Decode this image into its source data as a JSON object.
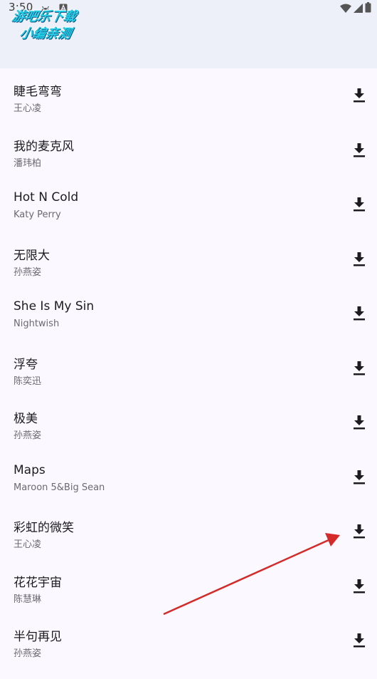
{
  "status_bar": {
    "time": "3:50",
    "icons": [
      "android-icon",
      "a-notification-icon",
      "wifi-icon",
      "signal-icon",
      "battery-icon"
    ]
  },
  "watermark": {
    "line1": "游吧乐下载",
    "line2": "小编亲测"
  },
  "songs": [
    {
      "title": "睫毛弯弯",
      "artist": "王心凌"
    },
    {
      "title": "我的麦克风",
      "artist": "潘玮柏"
    },
    {
      "title": "Hot N Cold",
      "artist": "Katy Perry"
    },
    {
      "title": "无限大",
      "artist": "孙燕姿"
    },
    {
      "title": "She Is My Sin",
      "artist": "Nightwish"
    },
    {
      "title": "浮夸",
      "artist": "陈奕迅"
    },
    {
      "title": "极美",
      "artist": "孙燕姿"
    },
    {
      "title": "Maps",
      "artist": "Maroon 5&Big Sean"
    },
    {
      "title": "彩虹的微笑",
      "artist": "王心凌"
    },
    {
      "title": "花花宇宙",
      "artist": "陈慧琳"
    },
    {
      "title": "半句再见",
      "artist": "孙燕姿"
    }
  ],
  "download_icon": "download-icon",
  "colors": {
    "header_bg": "#edf0f8",
    "list_bg": "#fbf9ff",
    "annotation_arrow": "#d42a2a"
  }
}
